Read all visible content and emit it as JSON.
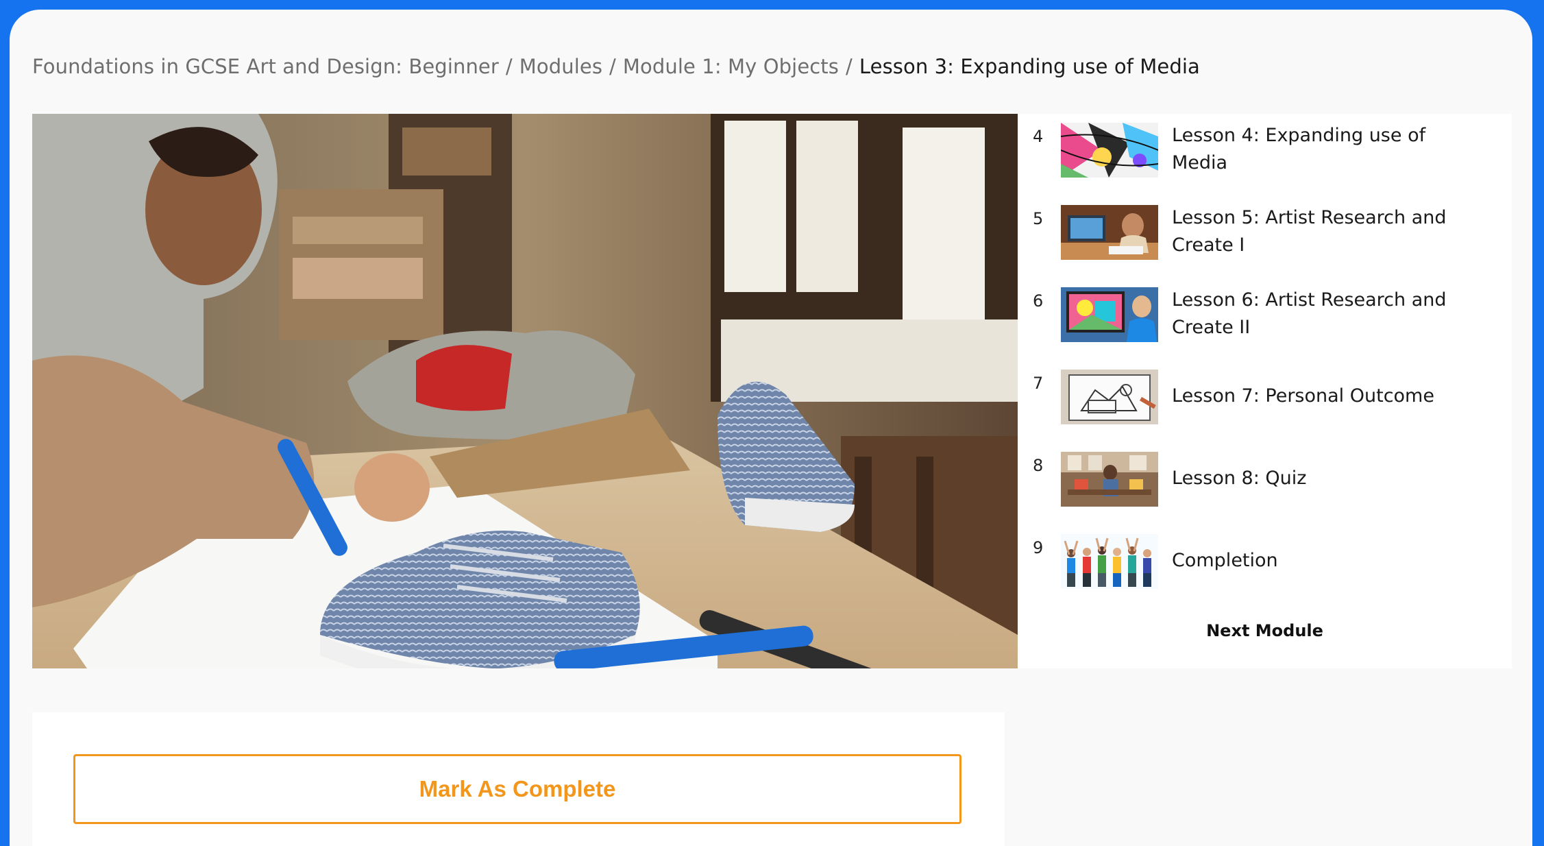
{
  "breadcrumb": {
    "course": "Foundations in GCSE Art and Design: Beginner",
    "modules": "Modules",
    "module": "Module 1: My Objects",
    "current": "Lesson 3: Expanding use of Media",
    "separator": "/"
  },
  "hero_image": {
    "description_icon": "student-drawing-sneaker-image"
  },
  "lessons": [
    {
      "number": "4",
      "title": "Lesson 4: Expanding use of Media",
      "thumb_icon": "abstract-pattern-thumbnail"
    },
    {
      "number": "5",
      "title": "Lesson 5: Artist Research and Create I",
      "thumb_icon": "student-laptop-thumbnail"
    },
    {
      "number": "6",
      "title": "Lesson 6: Artist Research and Create II",
      "thumb_icon": "colorful-screen-thumbnail"
    },
    {
      "number": "7",
      "title": "Lesson 7: Personal Outcome",
      "thumb_icon": "sketchbook-thumbnail"
    },
    {
      "number": "8",
      "title": "Lesson 8: Quiz",
      "thumb_icon": "art-studio-thumbnail"
    },
    {
      "number": "9",
      "title": "Completion",
      "thumb_icon": "celebrating-group-thumbnail"
    }
  ],
  "next_module_label": "Next Module",
  "mark_complete_label": "Mark As Complete",
  "colors": {
    "frame_border": "#1673f0",
    "accent_orange": "#f2961c",
    "page_bg": "#f9f9f9"
  }
}
